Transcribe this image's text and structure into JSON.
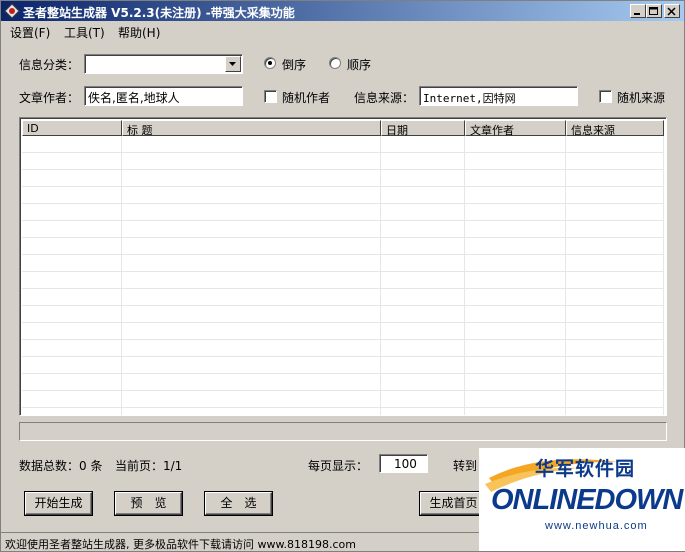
{
  "window": {
    "title": "圣者整站生成器 V5.2.3(未注册) -带强大采集功能"
  },
  "menu": [
    {
      "label": "设置(F)"
    },
    {
      "label": "工具(T)"
    },
    {
      "label": "帮助(H)"
    }
  ],
  "form": {
    "category_label": "信息分类：",
    "category_value": "",
    "order_desc_label": "倒序",
    "order_asc_label": "顺序",
    "order_selected": "倒序",
    "author_label": "文章作者：",
    "author_value": "佚名,匿名,地球人",
    "random_author_label": "随机作者",
    "source_label": "信息来源：",
    "source_value": "Internet,因特网",
    "random_source_label": "随机来源"
  },
  "table": {
    "columns": [
      "ID",
      "标 题",
      "日期",
      "文章作者",
      "信息来源"
    ],
    "rows": []
  },
  "footer": {
    "total_label": "数据总数：0 条",
    "current_page_label": "当前页：1/1",
    "per_page_label": "每页显示：",
    "per_page_value": "100",
    "goto_label": "转到"
  },
  "buttons": {
    "start": "开始生成",
    "preview": "预　览",
    "select_all": "全　选",
    "generate_home": "生成首页"
  },
  "status": {
    "text": "欢迎使用圣者整站生成器, 更多极品软件下载请访问 www.818198.com"
  },
  "watermark": {
    "cn": "华军软件园",
    "logo": "ONLINEDOWN",
    "url": "www.newhua.com"
  }
}
